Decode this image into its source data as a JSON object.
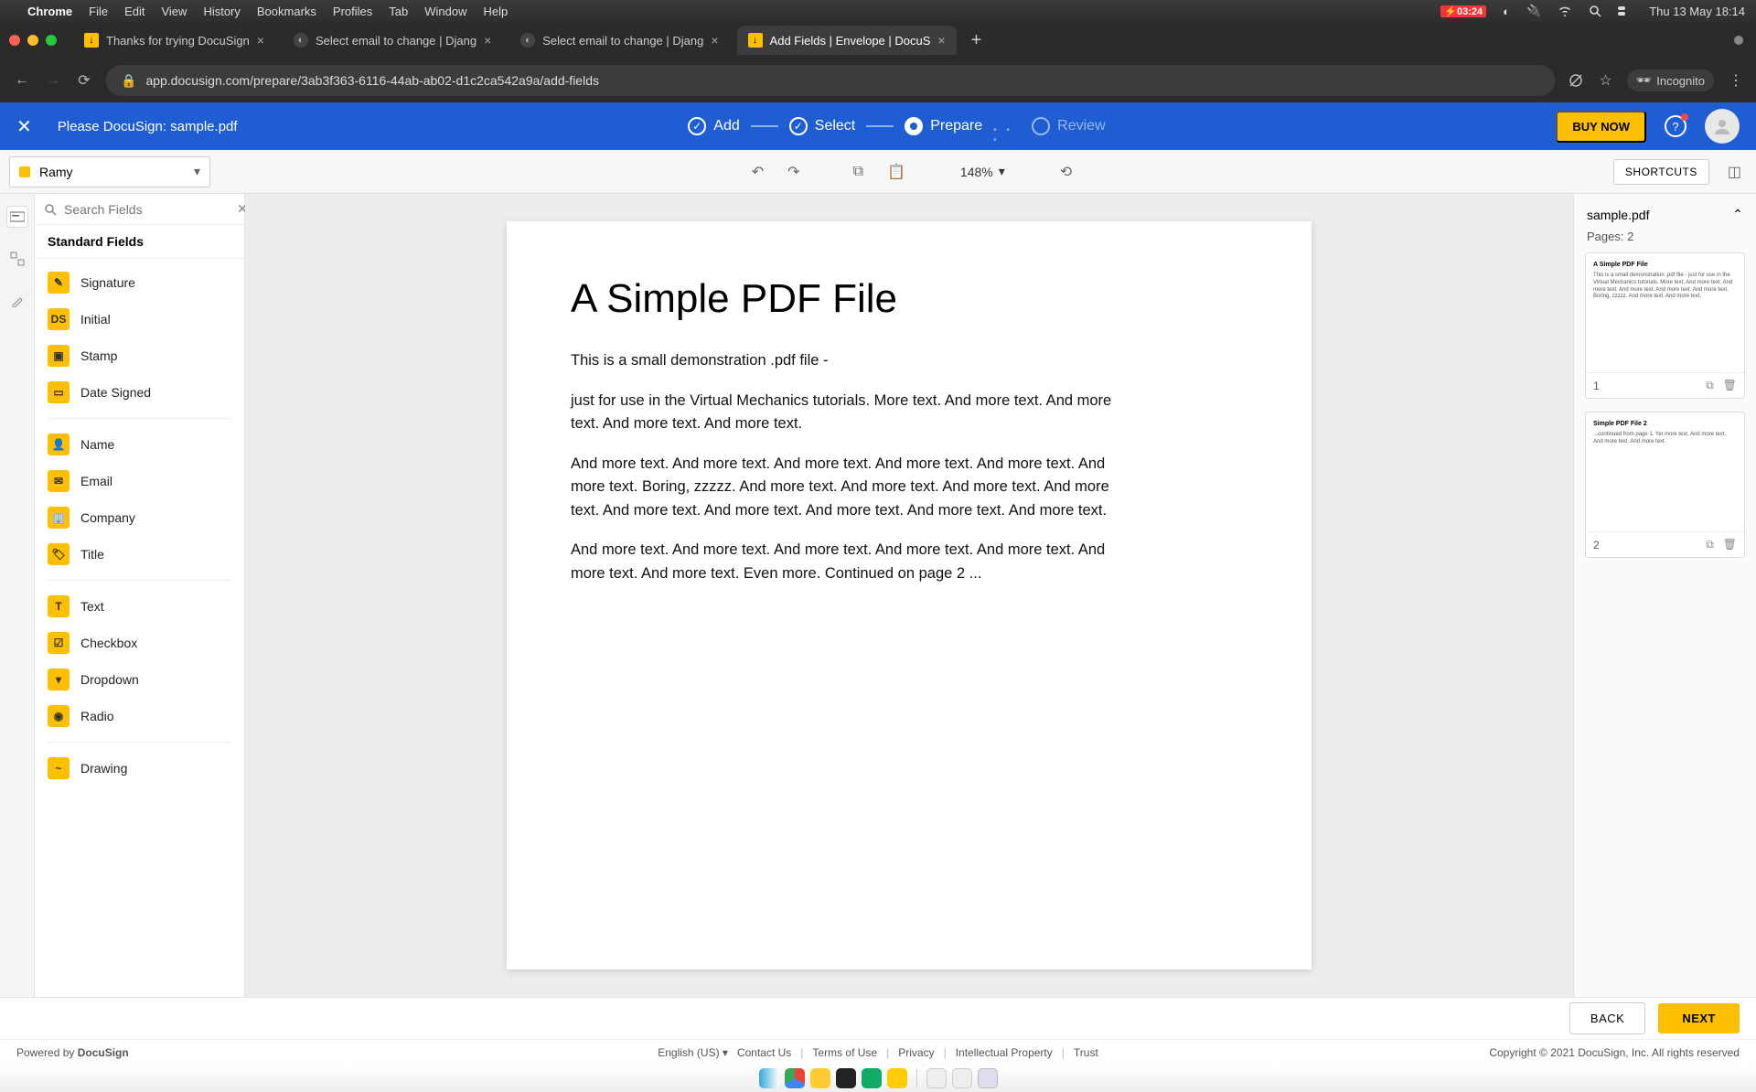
{
  "mac": {
    "apple": "",
    "app": "Chrome",
    "menus": [
      "File",
      "Edit",
      "View",
      "History",
      "Bookmarks",
      "Profiles",
      "Tab",
      "Window",
      "Help"
    ],
    "battery_time": "03:24",
    "clock": "Thu 13 May  18:14"
  },
  "chrome": {
    "tabs": [
      {
        "label": "Thanks for trying DocuSign",
        "favicon": "ds"
      },
      {
        "label": "Select email to change | Djang",
        "favicon": "dj"
      },
      {
        "label": "Select email to change | Djang",
        "favicon": "dj"
      },
      {
        "label": "Add Fields | Envelope | DocuS",
        "favicon": "ds",
        "active": true
      }
    ],
    "url": "app.docusign.com/prepare/3ab3f363-6116-44ab-ab02-d1c2ca542a9a/add-fields",
    "incognito": "Incognito"
  },
  "header": {
    "title": "Please DocuSign: sample.pdf",
    "steps": {
      "add": "Add",
      "select": "Select",
      "prepare": "Prepare",
      "review": "Review"
    },
    "buy": "BUY NOW"
  },
  "toolbar": {
    "recipient": "Ramy",
    "zoom": "148%",
    "shortcuts": "SHORTCUTS"
  },
  "sidebar": {
    "search_placeholder": "Search Fields",
    "group": "Standard Fields",
    "fields": [
      {
        "label": "Signature",
        "icon": "✎"
      },
      {
        "label": "Initial",
        "icon": "DS"
      },
      {
        "label": "Stamp",
        "icon": "▣"
      },
      {
        "label": "Date Signed",
        "icon": "▭"
      }
    ],
    "fields2": [
      {
        "label": "Name",
        "icon": "👤"
      },
      {
        "label": "Email",
        "icon": "✉"
      },
      {
        "label": "Company",
        "icon": "🏢"
      },
      {
        "label": "Title",
        "icon": "🏷"
      }
    ],
    "fields3": [
      {
        "label": "Text",
        "icon": "T"
      },
      {
        "label": "Checkbox",
        "icon": "☑"
      },
      {
        "label": "Dropdown",
        "icon": "▾"
      },
      {
        "label": "Radio",
        "icon": "◉"
      }
    ],
    "fields4": [
      {
        "label": "Drawing",
        "icon": "~"
      }
    ]
  },
  "doc": {
    "heading": "A Simple PDF File",
    "p1": "This is a small demonstration .pdf file -",
    "p2": "just for use in the Virtual Mechanics tutorials. More text. And more text. And more text. And more text. And more text.",
    "p3": "And more text. And more text. And more text. And more text. And more text. And more text. Boring, zzzzz. And more text. And more text. And more text. And more text. And more text. And more text. And more text. And more text. And more text.",
    "p4": "And more text. And more text. And more text. And more text. And more text. And more text. And more text. Even more. Continued on page 2 ..."
  },
  "thumbs": {
    "file": "sample.pdf",
    "pages_label": "Pages: 2",
    "items": [
      {
        "num": "1",
        "title": "A Simple PDF File"
      },
      {
        "num": "2",
        "title": "Simple PDF File 2"
      }
    ]
  },
  "actions": {
    "back": "BACK",
    "next": "NEXT"
  },
  "footer": {
    "powered": "Powered by ",
    "brand": "DocuSign",
    "lang": "English (US)",
    "links": [
      "Contact Us",
      "Terms of Use",
      "Privacy",
      "Intellectual Property",
      "Trust"
    ],
    "copy": "Copyright © 2021 DocuSign, Inc. All rights reserved"
  }
}
